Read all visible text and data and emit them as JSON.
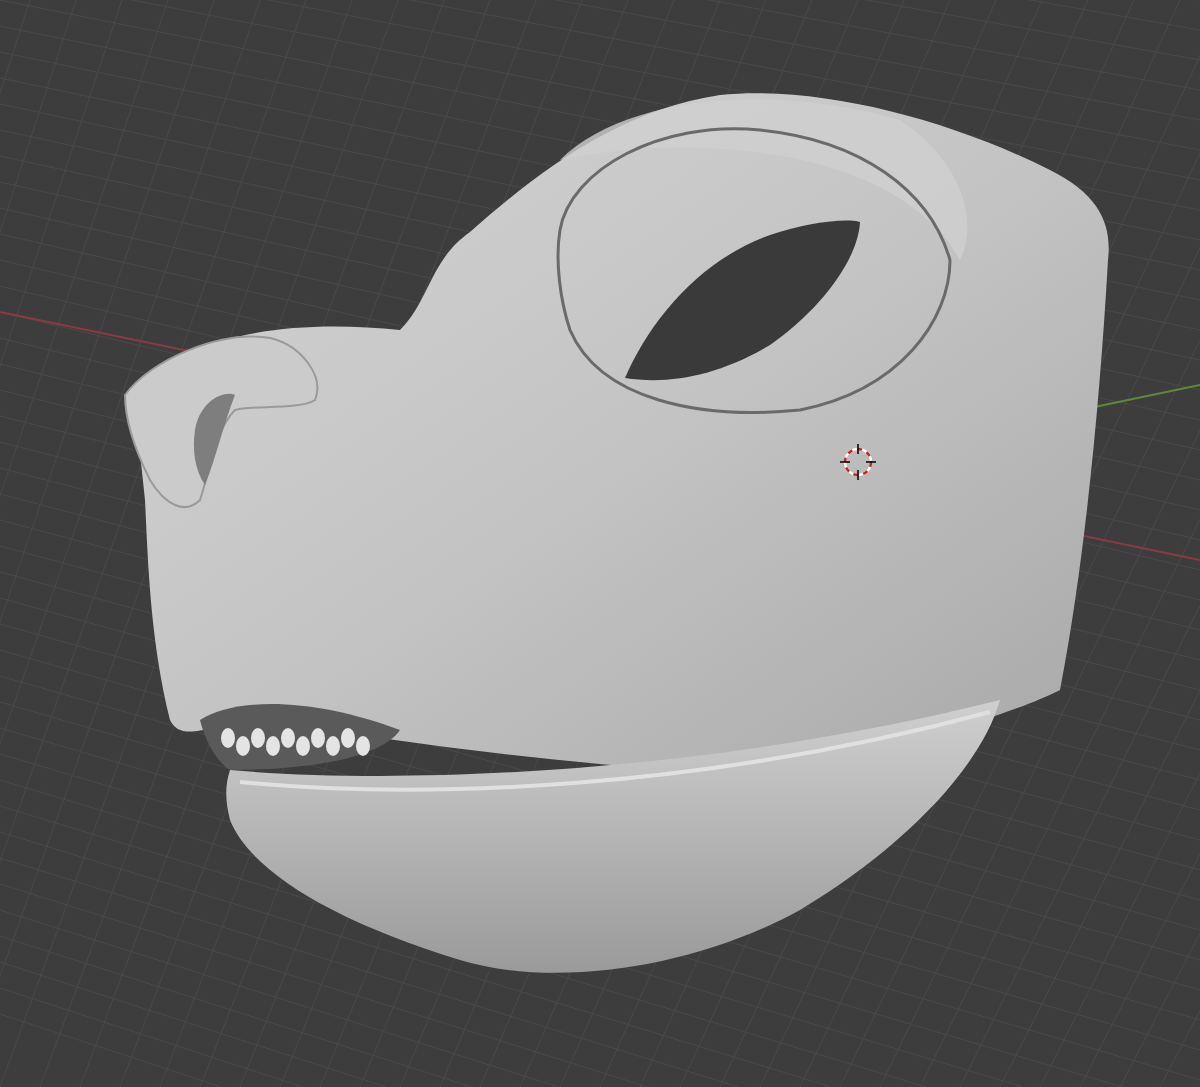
{
  "viewport": {
    "show_grid": true,
    "show_cursor": true
  }
}
